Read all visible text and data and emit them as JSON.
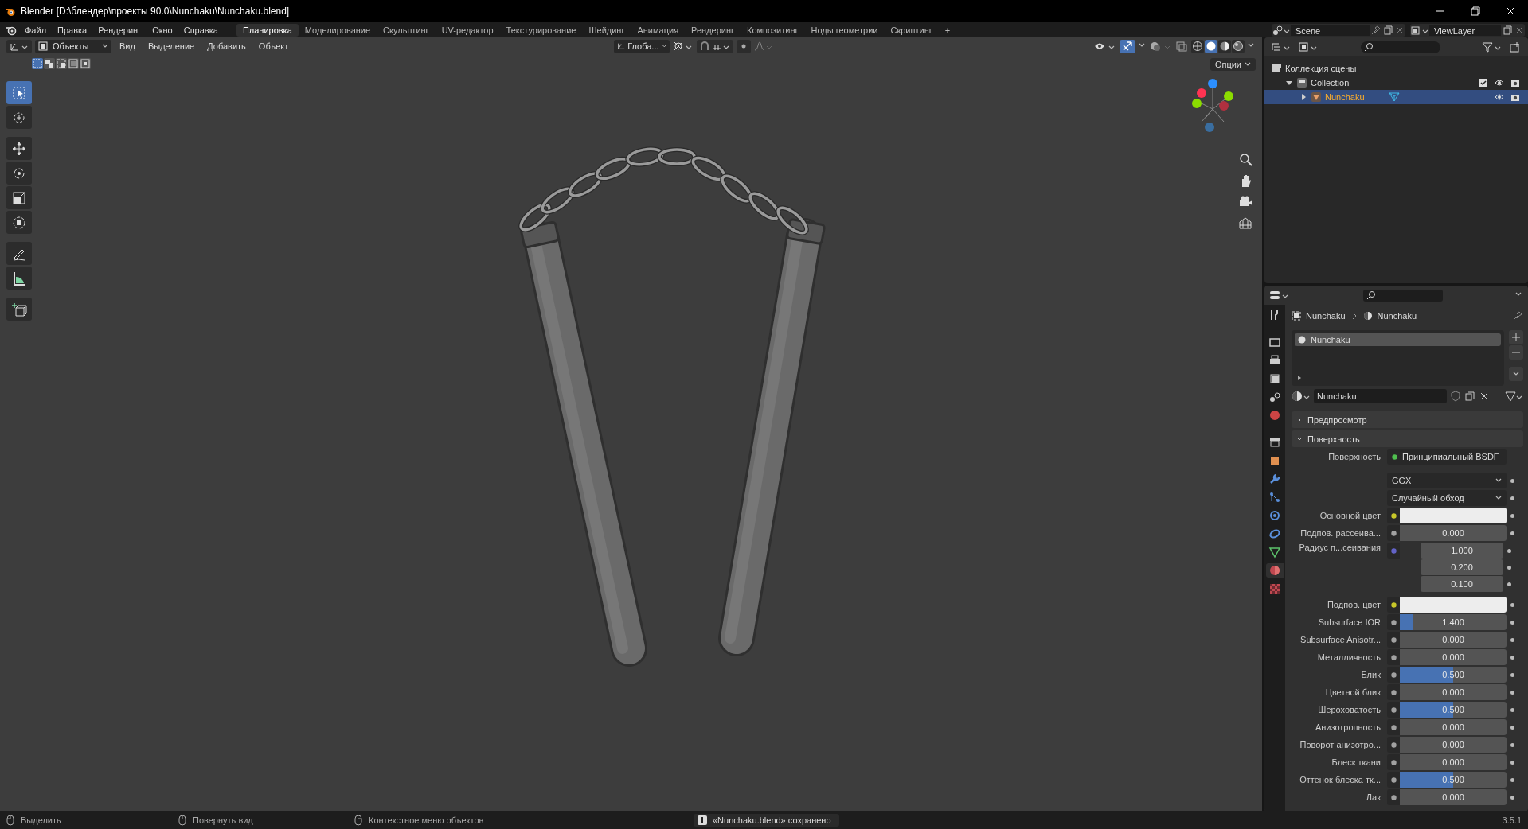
{
  "window": {
    "title": "Blender [D:\\блендер\\проекты 90.0\\Nunchaku\\Nunchaku.blend]"
  },
  "menu": [
    "Файл",
    "Правка",
    "Рендеринг",
    "Окно",
    "Справка"
  ],
  "workspaces": [
    {
      "label": "Планировка",
      "selected": true
    },
    {
      "label": "Моделирование",
      "selected": false
    },
    {
      "label": "Скульптинг",
      "selected": false
    },
    {
      "label": "UV-редактор",
      "selected": false
    },
    {
      "label": "Текстурирование",
      "selected": false
    },
    {
      "label": "Шейдинг",
      "selected": false
    },
    {
      "label": "Анимация",
      "selected": false
    },
    {
      "label": "Рендеринг",
      "selected": false
    },
    {
      "label": "Композитинг",
      "selected": false
    },
    {
      "label": "Ноды геометрии",
      "selected": false
    },
    {
      "label": "Скриптинг",
      "selected": false
    }
  ],
  "add_workspace": "+",
  "scene": "Scene",
  "view_layer": "ViewLayer",
  "viewport": {
    "mode": "Объекты",
    "menus": [
      "Вид",
      "Выделение",
      "Добавить",
      "Объект"
    ],
    "orientation": "Глоба...",
    "options": "Опции",
    "select_modes": [
      {
        "selected": true
      },
      {
        "selected": false
      },
      {
        "selected": false
      },
      {
        "selected": false
      },
      {
        "selected": false
      }
    ],
    "snap_toggle": {
      "on": false
    },
    "gizmo_toggle": {
      "on": true
    },
    "shading": [
      {
        "selected": false
      },
      {
        "selected": true
      },
      {
        "selected": false
      },
      {
        "selected": false
      }
    ],
    "tools": [
      {
        "selected": true
      },
      {
        "selected": false
      },
      {
        "selected": false
      },
      {
        "selected": false
      },
      {
        "selected": false
      },
      {
        "selected": false
      },
      {
        "selected": false
      },
      {
        "selected": false
      },
      {
        "selected": false
      }
    ]
  },
  "outliner": {
    "tree": [
      {
        "label": "Коллекция сцены",
        "children": [
          {
            "label": "Collection",
            "expanded": true,
            "checked": true,
            "selected": false,
            "children": [
              {
                "label": "Nunchaku",
                "expanded": false,
                "selected": true
              }
            ]
          }
        ]
      }
    ]
  },
  "properties": {
    "tabs": [
      {
        "selected": false
      },
      {
        "selected": false
      },
      {
        "selected": false
      },
      {
        "selected": false
      },
      {
        "selected": false
      },
      {
        "selected": false
      },
      {
        "selected": false
      },
      {
        "selected": false
      },
      {
        "selected": false
      },
      {
        "selected": false
      },
      {
        "selected": false
      },
      {
        "selected": false
      },
      {
        "selected": false
      },
      {
        "selected": true
      },
      {
        "selected": false
      }
    ],
    "breadcrumb": [
      "Nunchaku",
      "Nunchaku"
    ],
    "slots": [
      {
        "label": "Nunchaku",
        "selected": true
      }
    ],
    "material": "Nunchaku",
    "panels": [
      {
        "label": "Предпросмотр",
        "expanded": false
      },
      {
        "label": "Поверхность",
        "expanded": true
      }
    ],
    "rows": [
      {
        "kind": "shader",
        "label": "Поверхность",
        "value": "Принципиальный BSDF"
      },
      {
        "kind": "dropdown",
        "value": "GGX"
      },
      {
        "kind": "dropdown",
        "value": "Случайный обход"
      },
      {
        "kind": "color",
        "label": "Основной цвет",
        "color": "#ededed"
      },
      {
        "kind": "slider",
        "label": "Подпов. рассеива...",
        "value": "0.000",
        "level": 0
      },
      {
        "kind": "vector",
        "label": "Радиус п...сеивания",
        "values": [
          "1.000",
          "0.200",
          "0.100"
        ]
      },
      {
        "kind": "color",
        "label": "Подпов. цвет",
        "color": "#ededed"
      },
      {
        "kind": "slider",
        "label": "Subsurface IOR",
        "value": "1.400",
        "level": 0.13
      },
      {
        "kind": "slider",
        "label": "Subsurface Anisotr...",
        "value": "0.000",
        "level": 0
      },
      {
        "kind": "slider",
        "label": "Металличность",
        "value": "0.000",
        "level": 0
      },
      {
        "kind": "slider",
        "label": "Блик",
        "value": "0.500",
        "level": 0.5
      },
      {
        "kind": "slider",
        "label": "Цветной блик",
        "value": "0.000",
        "level": 0
      },
      {
        "kind": "slider",
        "label": "Шероховатость",
        "value": "0.500",
        "level": 0.5
      },
      {
        "kind": "slider",
        "label": "Анизотропность",
        "value": "0.000",
        "level": 0
      },
      {
        "kind": "slider",
        "label": "Поворот анизотро...",
        "value": "0.000",
        "level": 0
      },
      {
        "kind": "slider",
        "label": "Блеск ткани",
        "value": "0.000",
        "level": 0
      },
      {
        "kind": "slider",
        "label": "Оттенок блеска тк...",
        "value": "0.500",
        "level": 0.5
      },
      {
        "kind": "slider",
        "label": "Лак",
        "value": "0.000",
        "level": 0
      }
    ]
  },
  "status": {
    "hints": [
      "Выделить",
      "Повернуть вид",
      "Контекстное меню объектов"
    ],
    "message": "«Nunchaku.blend» сохранено",
    "version": "3.5.1"
  }
}
